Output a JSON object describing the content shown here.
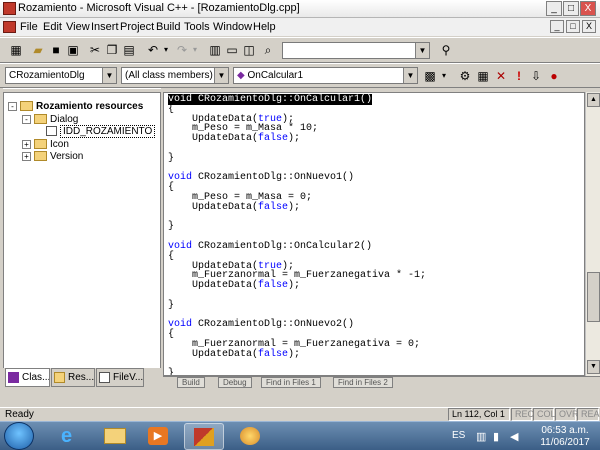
{
  "window": {
    "title": "Rozamiento - Microsoft Visual C++ - [RozamientoDlg.cpp]",
    "controls": [
      "_",
      "□",
      "X"
    ],
    "doc_controls": [
      "_",
      "□",
      "X"
    ]
  },
  "menu": [
    "File",
    "Edit",
    "View",
    "Insert",
    "Project",
    "Build",
    "Tools",
    "Window",
    "Help"
  ],
  "wizardbar": {
    "class_combo": "CRozamientoDlg",
    "filter_combo": "(All class members)",
    "member_combo": "OnCalcular1"
  },
  "workspace": {
    "tree": [
      {
        "label": "Rozamiento resources",
        "level": 0,
        "expander": "-"
      },
      {
        "label": "Dialog",
        "level": 1,
        "expander": "-"
      },
      {
        "label": "IDD_ROZAMIENTO",
        "level": 2,
        "expander": ""
      },
      {
        "label": "Icon",
        "level": 1,
        "expander": "+"
      },
      {
        "label": "Version",
        "level": 1,
        "expander": "+"
      }
    ],
    "tabs": [
      "Clas...",
      "Res...",
      "FileV..."
    ]
  },
  "code": {
    "lines": [
      "void CRozamientoDlg::OnCalcular1()",
      "{",
      "    UpdateData(true);",
      "    m_Peso = m_Masa * 10;",
      "    UpdateData(false);",
      "",
      "}",
      "",
      "void CRozamientoDlg::OnNuevo1()",
      "{",
      "    m_Peso = m_Masa = 0;",
      "    UpdateData(false);",
      "",
      "}",
      "",
      "void CRozamientoDlg::OnCalcular2()",
      "{",
      "    UpdateData(true);",
      "    m_Fuerzanormal = m_Fuerzanegativa * -1;",
      "    UpdateData(false);",
      "",
      "}",
      "",
      "void CRozamientoDlg::OnNuevo2()",
      "{",
      "    m_Fuerzanormal = m_Fuerzanegativa = 0;",
      "    UpdateData(false);",
      "",
      "}"
    ],
    "highlighted_line": 0
  },
  "output_tabs": [
    "Build",
    "Debug",
    "Find in Files 1",
    "Find in Files 2"
  ],
  "status": {
    "message": "Ready",
    "position": "Ln 112, Col 1",
    "indicators": [
      "REC",
      "COL",
      "OVR",
      "READ"
    ]
  },
  "taskbar": {
    "language": "ES",
    "time": "06:53 a.m.",
    "date": "11/06/2017"
  },
  "colors": {
    "keyword": "#0000ff",
    "taskbar": "#3b5e86"
  }
}
